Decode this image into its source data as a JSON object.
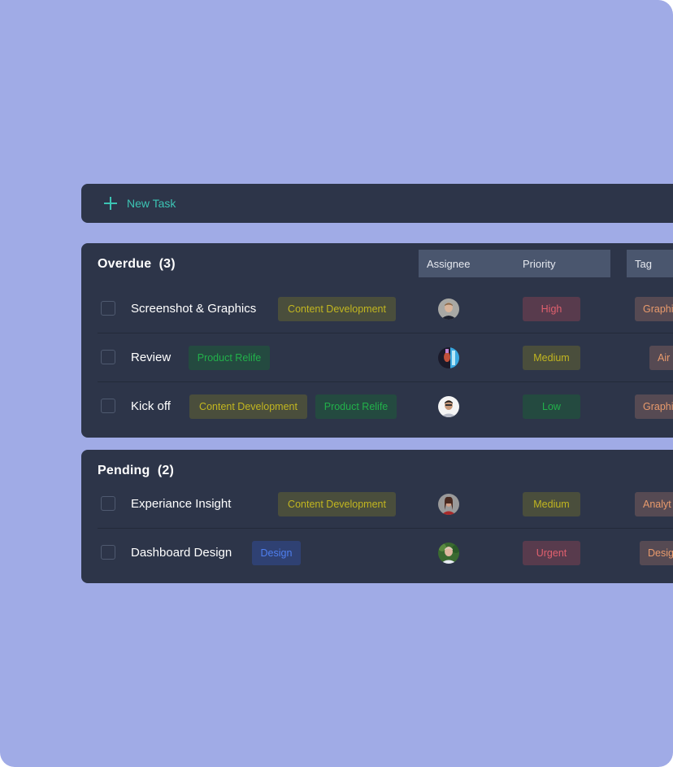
{
  "toolbar": {
    "new_task_label": "New Task",
    "icon": "plus-icon"
  },
  "columns": {
    "assignee": "Assignee",
    "priority": "Priority",
    "tag": "Tag"
  },
  "groups": [
    {
      "title": "Overdue",
      "count": "(3)",
      "tasks": [
        {
          "name": "Screenshot & Graphics",
          "labels": [
            "Content Development"
          ],
          "assignee": "avatar-man-blond",
          "priority": "High",
          "tag": "Graphi"
        },
        {
          "name": "Review",
          "labels": [
            "Product Relife"
          ],
          "assignee": "avatar-neon-portrait",
          "priority": "Medium",
          "tag": "Air"
        },
        {
          "name": "Kick off",
          "labels": [
            "Content Development",
            "Product Relife"
          ],
          "assignee": "avatar-man-glasses",
          "priority": "Low",
          "tag": "Graphi"
        }
      ]
    },
    {
      "title": "Pending",
      "count": "(2)",
      "tasks": [
        {
          "name": "Experiance Insight",
          "labels": [
            "Content Development"
          ],
          "assignee": "avatar-woman-red",
          "priority": "Medium",
          "tag": "Analyt"
        },
        {
          "name": "Dashboard Design",
          "labels": [
            "Design"
          ],
          "assignee": "avatar-man-outdoor",
          "priority": "Urgent",
          "tag": "Desig"
        }
      ]
    }
  ],
  "colors": {
    "background": "#a0abe6",
    "panel": "#2d3549",
    "accent": "#3cc4b4",
    "high": "#e0606e",
    "medium": "#c2b620",
    "low": "#22b04a",
    "tag_text": "#e89a6c"
  }
}
